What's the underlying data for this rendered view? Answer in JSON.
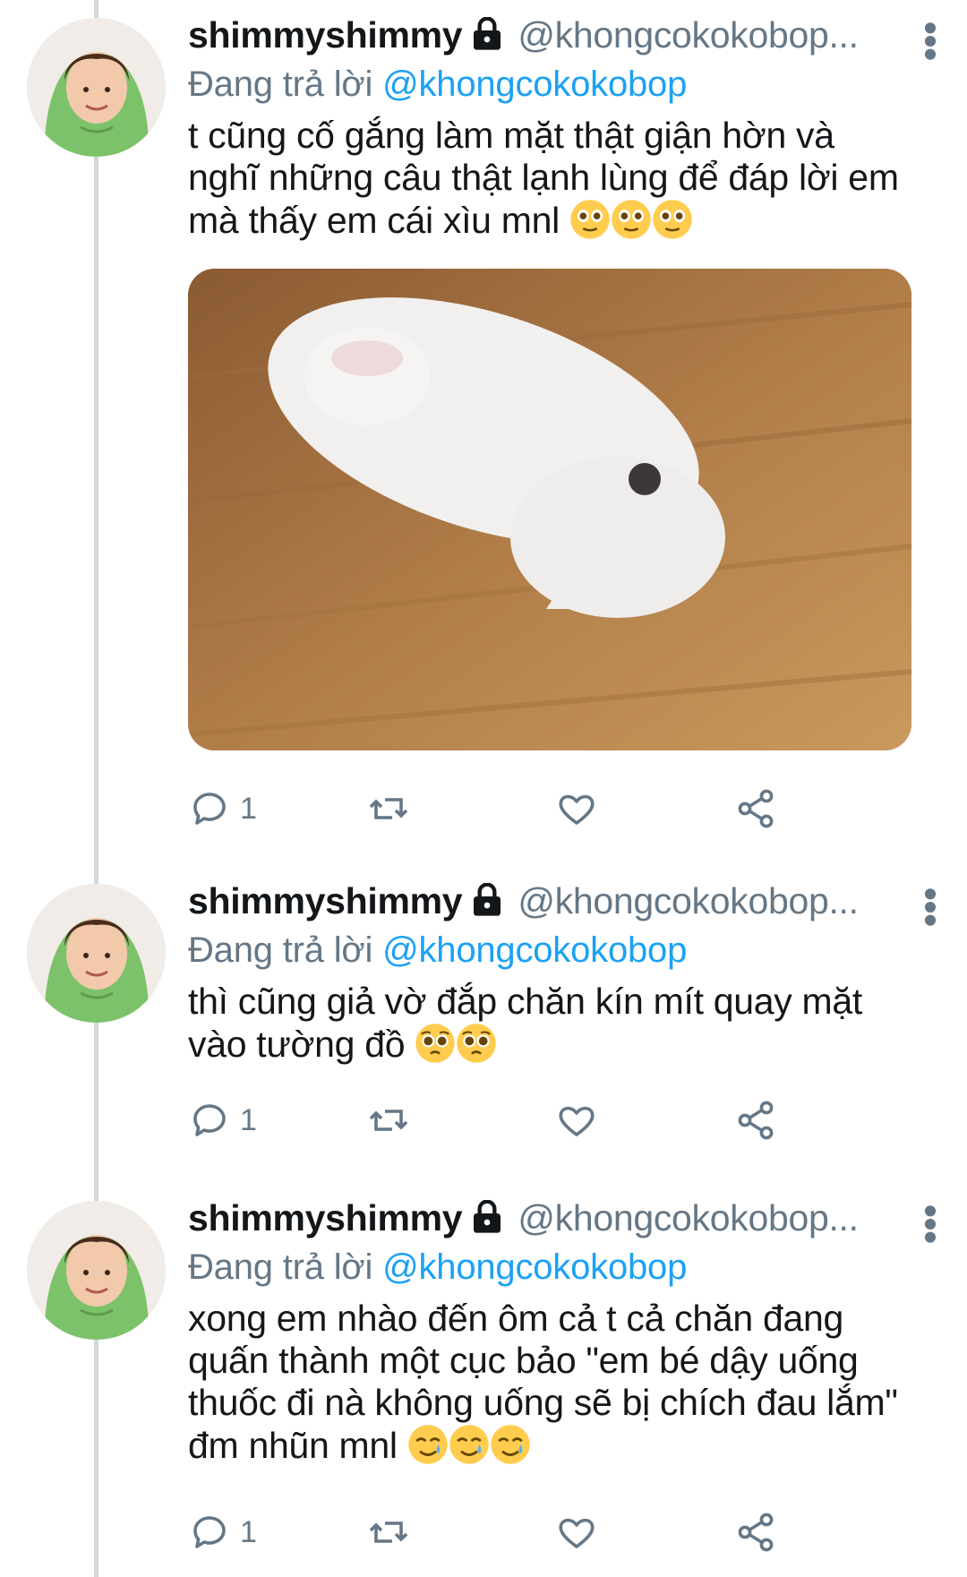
{
  "tweets": [
    {
      "display_name": "shimmyshimmy",
      "handle": "@khongcokokobop...",
      "replying_prefix": "Đang trả lời",
      "replying_to": "@khongcokokobop",
      "text": "t cũng cố gắng làm mặt thật giận hờn và nghĩ những câu thật lạnh lùng để đáp lời em mà thấy em cái xìu mnl",
      "emoji": [
        "face-holding-back-tears",
        "face-holding-back-tears",
        "face-holding-back-tears"
      ],
      "has_media": true,
      "media_description_icon": "white-dog-lying-on-wooden-floor",
      "reply_count": "1"
    },
    {
      "display_name": "shimmyshimmy",
      "handle": "@khongcokokobop...",
      "replying_prefix": "Đang trả lời",
      "replying_to": "@khongcokokobop",
      "text": "thì cũng giả vờ đắp chăn kín mít quay mặt vào tường đồ",
      "emoji": [
        "pleading-face",
        "pleading-face"
      ],
      "has_media": false,
      "reply_count": "1"
    },
    {
      "display_name": "shimmyshimmy",
      "handle": "@khongcokokobop...",
      "replying_prefix": "Đang trả lời",
      "replying_to": "@khongcokokobop",
      "text": "xong em nhào đến ôm cả t cả chăn đang quấn thành một cục bảo \"em bé dậy uống thuốc đi nà không uống sẽ bị chích đau lắm\" đm nhũn mnl",
      "emoji": [
        "smiling-face-with-tear",
        "smiling-face-with-tear",
        "smiling-face-with-tear"
      ],
      "has_media": false,
      "reply_count": "1"
    }
  ],
  "colors": {
    "link": "#1da1f2",
    "secondary_text": "#657786",
    "thread_line": "#cfd9de",
    "avatar_hood": "#7cc26a"
  }
}
